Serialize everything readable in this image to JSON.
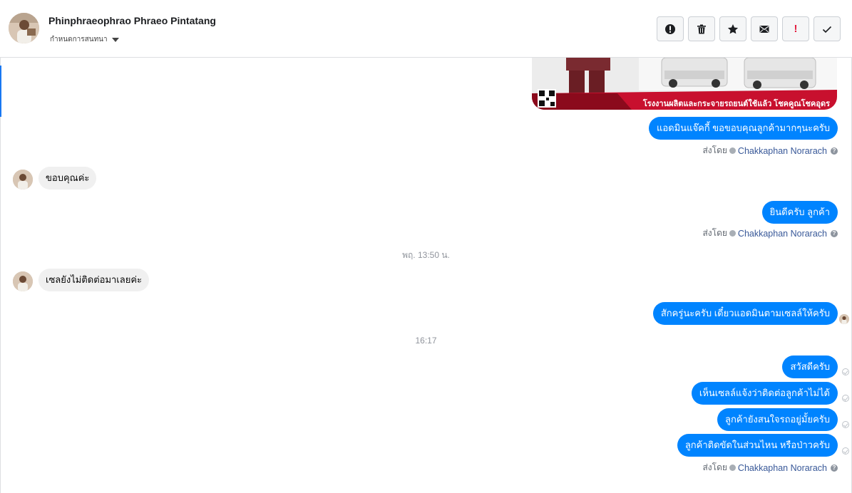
{
  "header": {
    "contact_name": "Phinphraeophrao Phraeo Pintatang",
    "assign_label": "กำหนดการสนทนา",
    "actions": [
      {
        "name": "mark-spam-button",
        "icon": "alert-circle-icon"
      },
      {
        "name": "delete-button",
        "icon": "trash-icon"
      },
      {
        "name": "star-button",
        "icon": "star-icon"
      },
      {
        "name": "mark-unread-button",
        "icon": "envelope-icon"
      },
      {
        "name": "follow-up-button",
        "icon": "exclamation-icon",
        "glyph": "!"
      },
      {
        "name": "mark-done-button",
        "icon": "check-icon"
      }
    ]
  },
  "thread": {
    "image_banner_text": "โรงงานผลิตและกระจายรถยนต์ใช้แล้ว โชคคูณโชคอุดร",
    "messages": [
      {
        "side": "out",
        "text": "แอดมินแจ๊คกี้ ขอขอบคุณลูกค้ามากๆนะครับ"
      },
      {
        "side": "in",
        "text": "ขอบคุณค่ะ"
      },
      {
        "side": "out",
        "text": "ยินดีครับ ลูกค้า"
      },
      {
        "side": "in",
        "text": "เซลยังไม่ติดต่อมาเลยค่ะ"
      },
      {
        "side": "out",
        "text": "สักครู่นะครับ เดี๋ยวแอดมินตามเซลล์ให้ครับ"
      },
      {
        "side": "out",
        "text": "สวัสดีครับ"
      },
      {
        "side": "out",
        "text": "เห็นเซลล์แจ้งว่าติดต่อลูกค้าไม่ได้"
      },
      {
        "side": "out",
        "text": "ลูกค้ายังสนใจรถอยู่มั้ยครับ"
      },
      {
        "side": "out",
        "text": "ลูกค้าติดขัดในส่วนไหน หรือป่าวครับ"
      }
    ],
    "sender": {
      "prefix": "ส่งโดย",
      "name": "Chakkaphan Norarach",
      "help": "?"
    },
    "time_separators": [
      "พฤ. 13:50 น.",
      "16:17"
    ]
  },
  "colors": {
    "outgoing_bubble": "#0084ff",
    "incoming_bubble": "#f0f0f0",
    "link": "#385898",
    "accent": "#1877f2"
  }
}
